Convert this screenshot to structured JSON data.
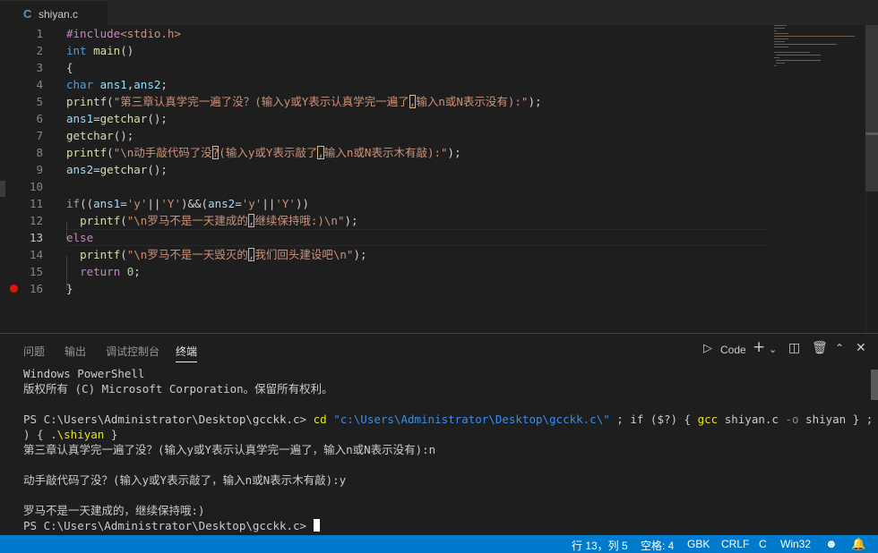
{
  "tab": {
    "icon": "C",
    "title": "shiyan.c"
  },
  "editor": {
    "line_numbers": [
      "1",
      "2",
      "3",
      "4",
      "5",
      "6",
      "7",
      "8",
      "9",
      "10",
      "11",
      "12",
      "13",
      "14",
      "15",
      "16"
    ],
    "active_line": "13",
    "breakpoint_line": "16",
    "lines": [
      [
        {
          "t": "#include",
          "c": "pp"
        },
        {
          "t": "<stdio.h>",
          "c": "st"
        }
      ],
      [
        {
          "t": "int",
          "c": "kw"
        },
        {
          "t": " ",
          "c": "op"
        },
        {
          "t": "main",
          "c": "fn"
        },
        {
          "t": "()",
          "c": "op"
        }
      ],
      [
        {
          "t": "{",
          "c": "op"
        }
      ],
      [
        {
          "t": "char",
          "c": "kw"
        },
        {
          "t": " ",
          "c": "op"
        },
        {
          "t": "ans1",
          "c": "vr"
        },
        {
          "t": ",",
          "c": "op"
        },
        {
          "t": "ans2",
          "c": "vr"
        },
        {
          "t": ";",
          "c": "op"
        }
      ],
      [
        {
          "t": "printf",
          "c": "fn"
        },
        {
          "t": "(",
          "c": "op"
        },
        {
          "t": "\"第三章认真学完一遍了没？(输入y或Y表示认真学完一遍了",
          "c": "st"
        },
        {
          "t": ",",
          "c": "st",
          "h": true
        },
        {
          "t": "输入n或N表示没有):\"",
          "c": "st"
        },
        {
          "t": ");",
          "c": "op"
        }
      ],
      [
        {
          "t": "ans1",
          "c": "vr"
        },
        {
          "t": "=",
          "c": "op"
        },
        {
          "t": "getchar",
          "c": "fn"
        },
        {
          "t": "();",
          "c": "op"
        }
      ],
      [
        {
          "t": "getchar",
          "c": "fn"
        },
        {
          "t": "();",
          "c": "op"
        }
      ],
      [
        {
          "t": "printf",
          "c": "fn"
        },
        {
          "t": "(",
          "c": "op"
        },
        {
          "t": "\"\\n动手敲代码了没",
          "c": "st"
        },
        {
          "t": "?",
          "c": "st",
          "h": true
        },
        {
          "t": "(输入y或Y表示敲了",
          "c": "st"
        },
        {
          "t": ",",
          "c": "st",
          "h": true
        },
        {
          "t": "输入n或N表示木有敲):\"",
          "c": "st"
        },
        {
          "t": ");",
          "c": "op"
        }
      ],
      [
        {
          "t": "ans2",
          "c": "vr"
        },
        {
          "t": "=",
          "c": "op"
        },
        {
          "t": "getchar",
          "c": "fn"
        },
        {
          "t": "();",
          "c": "op"
        }
      ],
      [],
      [
        {
          "t": "if",
          "c": "pp"
        },
        {
          "t": "((",
          "c": "op"
        },
        {
          "t": "ans1",
          "c": "vr"
        },
        {
          "t": "=",
          "c": "op"
        },
        {
          "t": "'y'",
          "c": "st"
        },
        {
          "t": "||",
          "c": "op"
        },
        {
          "t": "'Y'",
          "c": "st"
        },
        {
          "t": ")&&(",
          "c": "op"
        },
        {
          "t": "ans2",
          "c": "vr"
        },
        {
          "t": "=",
          "c": "op"
        },
        {
          "t": "'y'",
          "c": "st"
        },
        {
          "t": "||",
          "c": "op"
        },
        {
          "t": "'Y'",
          "c": "st"
        },
        {
          "t": "))",
          "c": "op"
        }
      ],
      [
        {
          "t": "  ",
          "c": "op"
        },
        {
          "t": "printf",
          "c": "fn"
        },
        {
          "t": "(",
          "c": "op"
        },
        {
          "t": "\"\\n罗马不是一天建成的",
          "c": "st"
        },
        {
          "t": ",",
          "c": "st",
          "h": true
        },
        {
          "t": "继续保持哦:)\\n\"",
          "c": "st"
        },
        {
          "t": ");",
          "c": "op"
        }
      ],
      [
        {
          "t": "else",
          "c": "pp"
        }
      ],
      [
        {
          "t": "  ",
          "c": "op"
        },
        {
          "t": "printf",
          "c": "fn"
        },
        {
          "t": "(",
          "c": "op"
        },
        {
          "t": "\"\\n罗马不是一天毁灭的",
          "c": "st"
        },
        {
          "t": ",",
          "c": "st",
          "h": true
        },
        {
          "t": "我们回头建设吧\\n\"",
          "c": "st"
        },
        {
          "t": ");",
          "c": "op"
        }
      ],
      [
        {
          "t": "  ",
          "c": "op"
        },
        {
          "t": "return",
          "c": "pp"
        },
        {
          "t": " ",
          "c": "op"
        },
        {
          "t": "0",
          "c": "nm"
        },
        {
          "t": ";",
          "c": "op"
        }
      ],
      [
        {
          "t": "}",
          "c": "op"
        }
      ]
    ]
  },
  "panel": {
    "tabs": [
      "问题",
      "输出",
      "调试控制台",
      "终端"
    ],
    "active_tab": "终端",
    "terminal_select": "Code",
    "icons": [
      "terminal-icon",
      "plus-icon",
      "chevron-down-icon",
      "split-icon",
      "trash-icon",
      "chevron-up-icon",
      "close-icon"
    ]
  },
  "terminal": {
    "line1": "Windows PowerShell",
    "line2": "版权所有 (C) Microsoft Corporation。保留所有权利。",
    "prompt1": "PS C:\\Users\\Administrator\\Desktop\\gcckk.c> ",
    "cmd_cd": "cd",
    "cmd_path": "\"c:\\Users\\Administrator\\Desktop\\gcckk.c\\\"",
    "cmd_mid1": " ; if ($?) { ",
    "cmd_gcc": "gcc",
    "cmd_mid2": " shiyan.c ",
    "cmd_flag": "-o",
    "cmd_mid3": " shiyan } ; if ($?",
    "cmd_wrap_a": ") { ",
    "cmd_run": ".\\shiyan",
    "cmd_wrap_b": " }",
    "out1": "第三章认真学完一遍了没？(输入y或Y表示认真学完一遍了，输入n或N表示没有):n",
    "out2": "动手敲代码了没？(输入y或Y表示敲了，输入n或N表示木有敲):y",
    "out3": "罗马不是一天建成的，继续保持哦:)",
    "prompt2": "PS C:\\Users\\Administrator\\Desktop\\gcckk.c> "
  },
  "status": {
    "position": "行 13，列 5",
    "spaces": "空格: 4",
    "encoding": "GBK",
    "eol": "CRLF",
    "language": "C",
    "platform": "Win32"
  },
  "colors": {
    "status_bg": "#007acc",
    "editor_bg": "#1e1e1e",
    "string": "#ce9178",
    "keyword": "#569cd6",
    "function": "#dcdcaa",
    "breakpoint": "#e51400"
  }
}
